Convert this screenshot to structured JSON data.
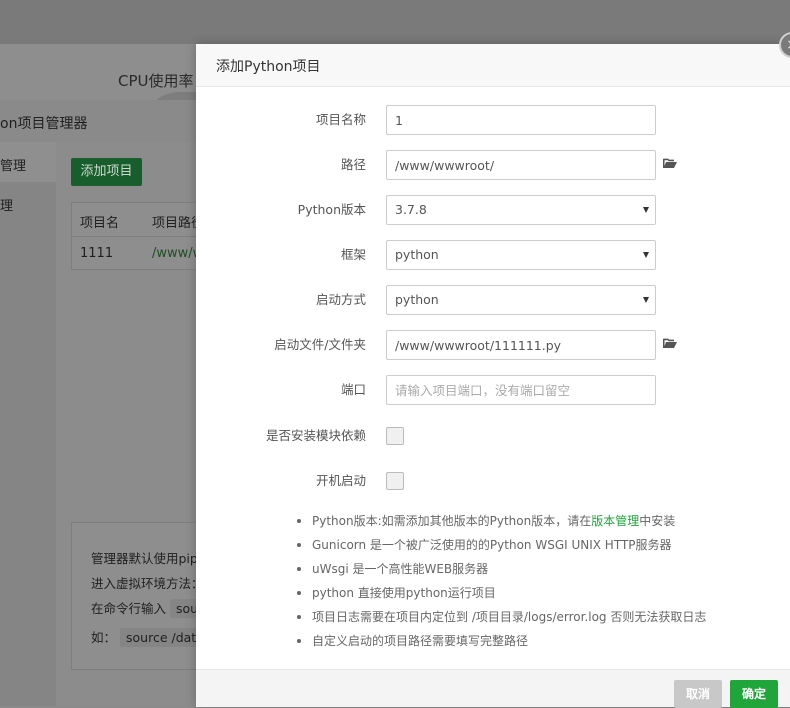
{
  "background": {
    "cpu_label": "CPU使用率",
    "panel_title": "on项目管理器",
    "side_items": [
      "管理",
      "理"
    ],
    "add_button": "添加项目",
    "table_headers": [
      "项目名",
      "项目路径"
    ],
    "table_row": [
      "1111",
      "/www/w"
    ],
    "note_lines": [
      "管理器默认使用pip",
      "进入虚拟环境方法：",
      "在命令行输入",
      "如："
    ],
    "note_codes": [
      "sou",
      "source /data"
    ],
    "close_glyph": "×"
  },
  "modal": {
    "title": "添加Python项目",
    "fields": {
      "name": {
        "label": "项目名称",
        "value": "1"
      },
      "path": {
        "label": "路径",
        "value": "/www/wwwroot/"
      },
      "python_version": {
        "label": "Python版本",
        "value": "3.7.8"
      },
      "framework": {
        "label": "框架",
        "value": "python"
      },
      "start_mode": {
        "label": "启动方式",
        "value": "python"
      },
      "start_file": {
        "label": "启动文件/文件夹",
        "value": "/www/wwwroot/111111.py"
      },
      "port": {
        "label": "端口",
        "value": "",
        "placeholder": "请输入项目端口，没有端口留空"
      },
      "install_deps": {
        "label": "是否安装模块依赖",
        "checked": false
      },
      "autostart": {
        "label": "开机启动",
        "checked": false
      }
    },
    "tips": {
      "tip1_pre": "Python版本:如需添加其他版本的Python版本，请在",
      "tip1_link": "版本管理",
      "tip1_post": "中安装",
      "tip2": "Gunicorn 是一个被广泛使用的的Python WSGI UNIX HTTP服务器",
      "tip3": "uWsgi 是一个高性能WEB服务器",
      "tip4": "python 直接使用python运行项目",
      "tip5": "项目日志需要在项目内定位到 /项目目录/logs/error.log 否则无法获取日志",
      "tip6": "自定义启动的项目路径需要填写完整路径"
    },
    "buttons": {
      "cancel": "取消",
      "ok": "确定"
    }
  },
  "colors": {
    "accent": "#20a53a",
    "link": "#20a53a"
  }
}
